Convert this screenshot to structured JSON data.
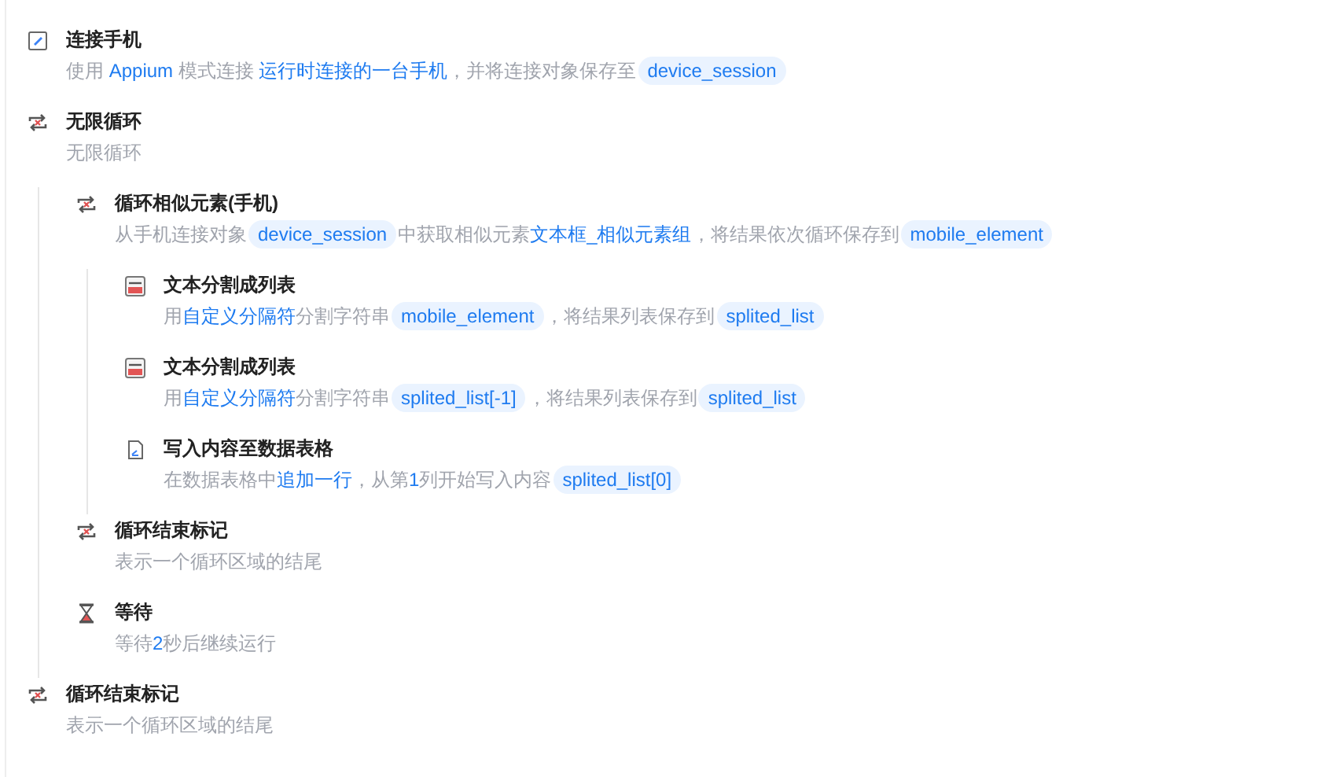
{
  "steps": [
    {
      "kind": "connect",
      "title": "连接手机",
      "description": [
        {
          "kind": "text",
          "text": "使用 "
        },
        {
          "kind": "link",
          "text": "Appium"
        },
        {
          "kind": "text",
          "text": " 模式连接 "
        },
        {
          "kind": "link",
          "text": "运行时连接的一台手机"
        },
        {
          "kind": "text",
          "text": "，并将连接对象保存至"
        },
        {
          "kind": "var",
          "text": "device_session"
        }
      ]
    },
    {
      "kind": "loop",
      "title": "无限循环",
      "description": [
        {
          "kind": "text",
          "text": "无限循环"
        }
      ],
      "children": [
        {
          "kind": "loop",
          "title": "循环相似元素(手机)",
          "description": [
            {
              "kind": "text",
              "text": "从手机连接对象"
            },
            {
              "kind": "var",
              "text": "device_session"
            },
            {
              "kind": "text",
              "text": "中获取相似元素"
            },
            {
              "kind": "link",
              "text": "文本框_相似元素组"
            },
            {
              "kind": "text",
              "text": "，将结果依次循环保存到"
            },
            {
              "kind": "var",
              "text": "mobile_element"
            }
          ],
          "children": [
            {
              "kind": "split",
              "title": "文本分割成列表",
              "description": [
                {
                  "kind": "text",
                  "text": "用"
                },
                {
                  "kind": "link",
                  "text": "自定义分隔符"
                },
                {
                  "kind": "text",
                  "text": "分割字符串"
                },
                {
                  "kind": "var",
                  "text": "mobile_element"
                },
                {
                  "kind": "text",
                  "text": "，将结果列表保存到"
                },
                {
                  "kind": "var",
                  "text": "splited_list"
                }
              ]
            },
            {
              "kind": "split",
              "title": "文本分割成列表",
              "description": [
                {
                  "kind": "text",
                  "text": "用"
                },
                {
                  "kind": "link",
                  "text": "自定义分隔符"
                },
                {
                  "kind": "text",
                  "text": "分割字符串"
                },
                {
                  "kind": "var",
                  "text": "splited_list[-1]"
                },
                {
                  "kind": "text",
                  "text": "，将结果列表保存到"
                },
                {
                  "kind": "var",
                  "text": "splited_list"
                }
              ]
            },
            {
              "kind": "write",
              "title": "写入内容至数据表格",
              "description": [
                {
                  "kind": "text",
                  "text": "在数据表格中"
                },
                {
                  "kind": "link",
                  "text": "追加一行"
                },
                {
                  "kind": "text",
                  "text": "，从第"
                },
                {
                  "kind": "link",
                  "text": "1"
                },
                {
                  "kind": "text",
                  "text": "列开始写入内容"
                },
                {
                  "kind": "var",
                  "text": "splited_list[0]"
                }
              ]
            }
          ]
        },
        {
          "kind": "loop",
          "title": "循环结束标记",
          "description": [
            {
              "kind": "text",
              "text": "表示一个循环区域的结尾"
            }
          ]
        },
        {
          "kind": "wait",
          "title": "等待",
          "description": [
            {
              "kind": "text",
              "text": "等待"
            },
            {
              "kind": "link",
              "text": "2"
            },
            {
              "kind": "text",
              "text": "秒后继续运行"
            }
          ]
        }
      ]
    },
    {
      "kind": "loop",
      "title": "循环结束标记",
      "description": [
        {
          "kind": "text",
          "text": "表示一个循环区域的结尾"
        }
      ]
    }
  ]
}
